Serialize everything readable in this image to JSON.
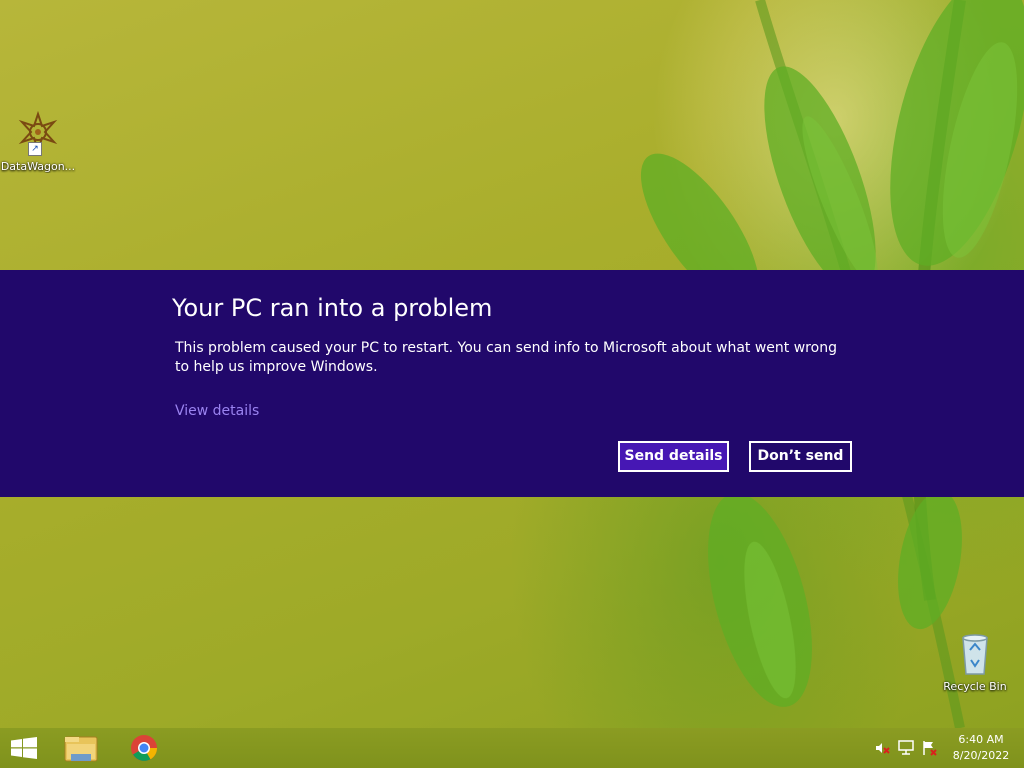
{
  "desktop": {
    "icons": [
      {
        "label": "DataWagon..."
      },
      {
        "label": "Recycle Bin"
      }
    ]
  },
  "error_dialog": {
    "title": "Your PC ran into a problem",
    "message": "This problem caused your PC to restart. You can send info to Microsoft about what went wrong to help us improve Windows.",
    "view_details_link": "View details",
    "send_button": "Send details",
    "dont_send_button": "Don’t send",
    "colors": {
      "background": "#21086b",
      "send_button_fill": "#4617b4",
      "link": "#9a83f0",
      "text": "#ffffff"
    }
  },
  "taskbar": {
    "pinned": [
      {
        "name": "windows-start-icon"
      },
      {
        "name": "file-explorer-icon"
      },
      {
        "name": "chrome-icon"
      }
    ],
    "tray": [
      {
        "name": "volume-muted-icon"
      },
      {
        "name": "network-icon"
      },
      {
        "name": "action-center-flag-icon"
      }
    ],
    "clock": {
      "time": "6:40 AM",
      "date": "8/20/2022"
    }
  }
}
